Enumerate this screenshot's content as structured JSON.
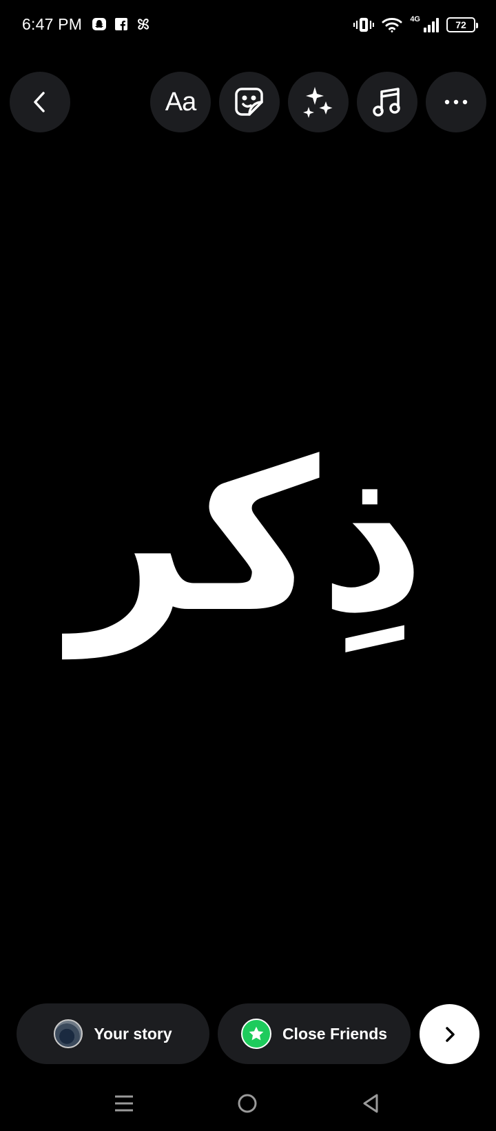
{
  "status_bar": {
    "time": "6:47 PM",
    "notification_icons": [
      "snapchat-icon",
      "facebook-icon",
      "pinwheel-icon"
    ],
    "network_label": "4G",
    "battery_level": "72"
  },
  "toolbar": {
    "back_icon": "chevron-left-icon",
    "text_tool_label": "Aa",
    "sticker_icon": "sticker-icon",
    "effects_icon": "sparkles-icon",
    "music_icon": "music-note-icon",
    "more_icon": "more-horizontal-icon"
  },
  "canvas": {
    "story_text": "ذِكر"
  },
  "share_bar": {
    "your_story_label": "Your story",
    "close_friends_label": "Close Friends",
    "next_icon": "chevron-right-icon"
  },
  "colors": {
    "background": "#000000",
    "button_bg": "#1c1d20",
    "close_friends_green": "#1ecb5c",
    "text": "#ffffff"
  }
}
